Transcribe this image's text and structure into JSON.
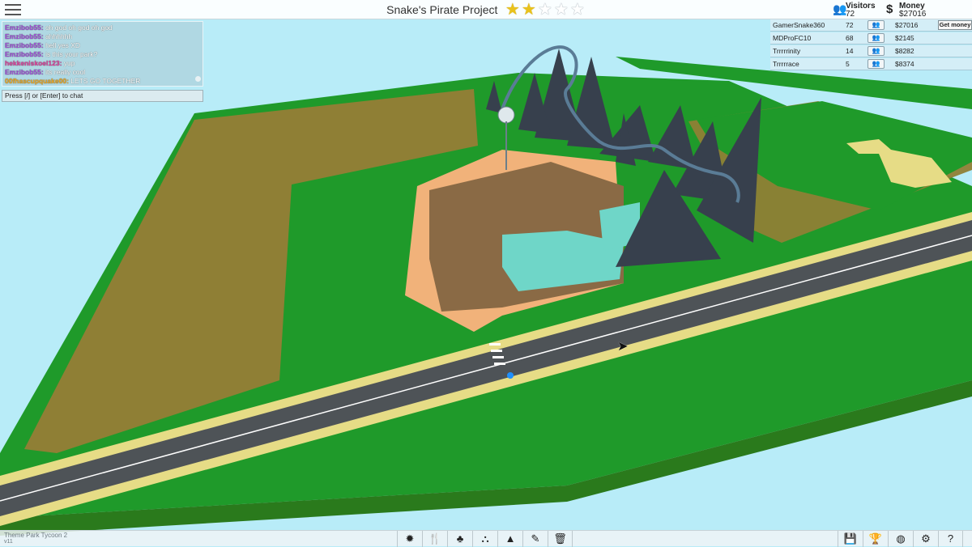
{
  "park": {
    "title": "Snake's Pirate Project",
    "stars_total": 5,
    "stars_filled": 2
  },
  "stats": {
    "visitors_label": "Visitors",
    "visitors_value": "72",
    "visitors_icon": "people-icon",
    "money_label": "Money",
    "money_value": "$27016",
    "money_icon": "dollar-icon"
  },
  "chat": {
    "messages": [
      {
        "user": "Emzibob55:",
        "text": " oh god oh god oh god",
        "color": "#a14fd8"
      },
      {
        "user": "Emzibob55:",
        "text": " ahhhhhh",
        "color": "#a14fd8"
      },
      {
        "user": "Emzibob55:",
        "text": " hell yes XD",
        "color": "#a14fd8"
      },
      {
        "user": "Emzibob55:",
        "text": " is this your park?",
        "color": "#a14fd8"
      },
      {
        "user": "hekkeniskoel123:",
        "text": " yup",
        "color": "#e33d9c"
      },
      {
        "user": "Emzibob55:",
        "text": " its really cool",
        "color": "#a14fd8"
      },
      {
        "user": "00fhascupquake00:",
        "text": " LETS GO TOGETHER",
        "color": "#f2a91c"
      }
    ],
    "input_hint": "Press [/] or [Enter] to chat"
  },
  "players": [
    {
      "name": "GamerSnake360",
      "visitors": "72",
      "money": "$27016",
      "action": "Get money"
    },
    {
      "name": "MDProFC10",
      "visitors": "68",
      "money": "$2145"
    },
    {
      "name": "Trrrrrinity",
      "visitors": "14",
      "money": "$8282"
    },
    {
      "name": "Trrrrrace",
      "visitors": "5",
      "money": "$8374"
    }
  ],
  "footer": {
    "game_name": "Theme Park Tycoon 2",
    "version": "v11"
  },
  "toolbar_left": [
    {
      "name": "rides-tool",
      "icon": "ferris-wheel-icon",
      "glyph": "✹"
    },
    {
      "name": "food-tool",
      "icon": "fork-knife-icon",
      "glyph": "🍴"
    },
    {
      "name": "scenery-tool",
      "icon": "tree-icon",
      "glyph": "♣"
    },
    {
      "name": "paths-tool",
      "icon": "path-icon",
      "glyph": "⛬"
    },
    {
      "name": "terrain-tool",
      "icon": "mountain-icon",
      "glyph": "▲"
    },
    {
      "name": "paint-tool",
      "icon": "paint-icon",
      "glyph": "✎"
    },
    {
      "name": "delete-tool",
      "icon": "trash-icon",
      "glyph": "🗑"
    }
  ],
  "toolbar_right": [
    {
      "name": "save-tool",
      "icon": "save-icon",
      "glyph": "💾"
    },
    {
      "name": "awards-tool",
      "icon": "trophy-icon",
      "glyph": "🏆"
    },
    {
      "name": "world-tool",
      "icon": "globe-icon",
      "glyph": "◍"
    },
    {
      "name": "settings-tool",
      "icon": "gear-icon",
      "glyph": "⚙"
    },
    {
      "name": "help-tool",
      "icon": "question-icon",
      "glyph": "?"
    }
  ],
  "colors": {
    "sky": "#b8ecf8",
    "grass": "#1f9a2a",
    "dirt": "#8f7f35",
    "road": "#4e5357",
    "sidewalk": "#e6dc86",
    "star_on": "#e9c21b"
  }
}
